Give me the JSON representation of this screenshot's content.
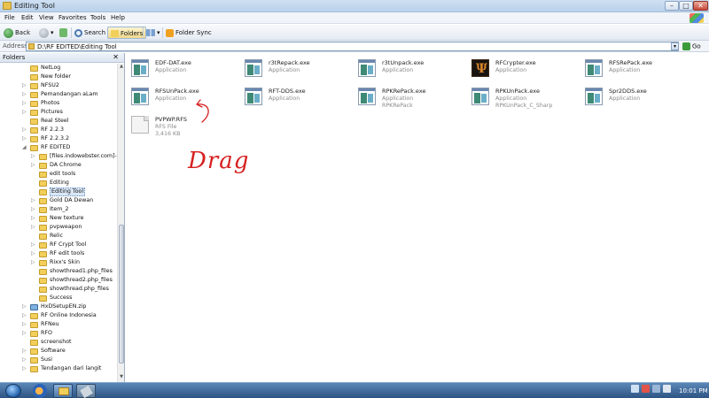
{
  "window": {
    "title": "Editing Tool",
    "min_glyph": "–",
    "max_glyph": "□",
    "close_glyph": "✕"
  },
  "menu": [
    "File",
    "Edit",
    "View",
    "Favorites",
    "Tools",
    "Help"
  ],
  "toolbar": {
    "back": "Back",
    "forward_arrow": "▾",
    "search": "Search",
    "folders": "Folders",
    "views_arrow": "▾",
    "folder_sync": "Folder Sync"
  },
  "address": {
    "label": "Address",
    "path": "D:\\RF EDITED\\Editing Tool",
    "go": "Go"
  },
  "folders_pane": {
    "title": "Folders",
    "close": "✕",
    "tree": [
      {
        "label": "NetLog",
        "exp": ""
      },
      {
        "label": "New folder",
        "exp": ""
      },
      {
        "label": "NFSU2",
        "exp": "▷"
      },
      {
        "label": "Pemandangan aLam",
        "exp": "▷"
      },
      {
        "label": "Photos",
        "exp": "▷"
      },
      {
        "label": "Pictures",
        "exp": "▷"
      },
      {
        "label": "Real Steel",
        "exp": ""
      },
      {
        "label": "RF 2.2.3",
        "exp": "▷"
      },
      {
        "label": "RF 2.2.3.2",
        "exp": "▷"
      },
      {
        "label": "RF EDITED",
        "exp": "◢"
      },
      {
        "label": "[files.indowebster.com]-C",
        "exp": "▷"
      },
      {
        "label": "DA Chrome",
        "exp": "▷"
      },
      {
        "label": "edit tools",
        "exp": ""
      },
      {
        "label": "Editing",
        "exp": ""
      },
      {
        "label": "Editing Tool",
        "exp": ""
      },
      {
        "label": "Gold DA Dewan",
        "exp": "▷"
      },
      {
        "label": "Item_2",
        "exp": "▷"
      },
      {
        "label": "New texture",
        "exp": "▷"
      },
      {
        "label": "pvpweapon",
        "exp": "▷"
      },
      {
        "label": "Relic",
        "exp": ""
      },
      {
        "label": "RF Crypt Tool",
        "exp": "▷"
      },
      {
        "label": "RF edit tools",
        "exp": "▷"
      },
      {
        "label": "Rixx's Skin",
        "exp": "▷"
      },
      {
        "label": "showthread1.php_files",
        "exp": ""
      },
      {
        "label": "showthread2.php_files",
        "exp": ""
      },
      {
        "label": "showthread.php_files",
        "exp": ""
      },
      {
        "label": "Success",
        "exp": ""
      },
      {
        "label": "HxDSetupEN.zip",
        "exp": "▷"
      },
      {
        "label": "RF Online Indonesia",
        "exp": "▷"
      },
      {
        "label": "RFNeu",
        "exp": "▷"
      },
      {
        "label": "RFO",
        "exp": "▷"
      },
      {
        "label": "screenshot",
        "exp": ""
      },
      {
        "label": "Software",
        "exp": "▷"
      },
      {
        "label": "Susi",
        "exp": "▷"
      },
      {
        "label": "Tendangan dari langit",
        "exp": "▷"
      }
    ]
  },
  "files": [
    {
      "name": "EDF-DAT.exe",
      "type": "Application",
      "extra": "",
      "icon": "app"
    },
    {
      "name": "r3tRepack.exe",
      "type": "Application",
      "extra": "",
      "icon": "app"
    },
    {
      "name": "r3tUnpack.exe",
      "type": "Application",
      "extra": "",
      "icon": "app"
    },
    {
      "name": "RFCrypter.exe",
      "type": "Application",
      "extra": "",
      "icon": "app-dark"
    },
    {
      "name": "RFSRePack.exe",
      "type": "Application",
      "extra": "",
      "icon": "app"
    },
    {
      "name": "RFSUnPack.exe",
      "type": "Application",
      "extra": "",
      "icon": "app"
    },
    {
      "name": "RFT-DDS.exe",
      "type": "Application",
      "extra": "",
      "icon": "app"
    },
    {
      "name": "RPKRePack.exe",
      "type": "Application",
      "extra": "RPKRePack",
      "icon": "app"
    },
    {
      "name": "RPKUnPack.exe",
      "type": "Application",
      "extra": "RPKUnPack_C_Sharp",
      "icon": "app"
    },
    {
      "name": "Spr2DDS.exe",
      "type": "Application",
      "extra": "",
      "icon": "app"
    },
    {
      "name": "PVPWP.RFS",
      "type": "RFS File",
      "extra": "3,416 KB",
      "icon": "doc"
    }
  ],
  "annotation": {
    "drag_text": "Drag",
    "color": "#d62020"
  },
  "taskbar": {
    "clock": "10:01 PM"
  },
  "colors": {
    "titlebar": "#cfe0f3",
    "taskbar": "#2d5583",
    "folder": "#f1cf5a",
    "annotation": "#d62020"
  }
}
